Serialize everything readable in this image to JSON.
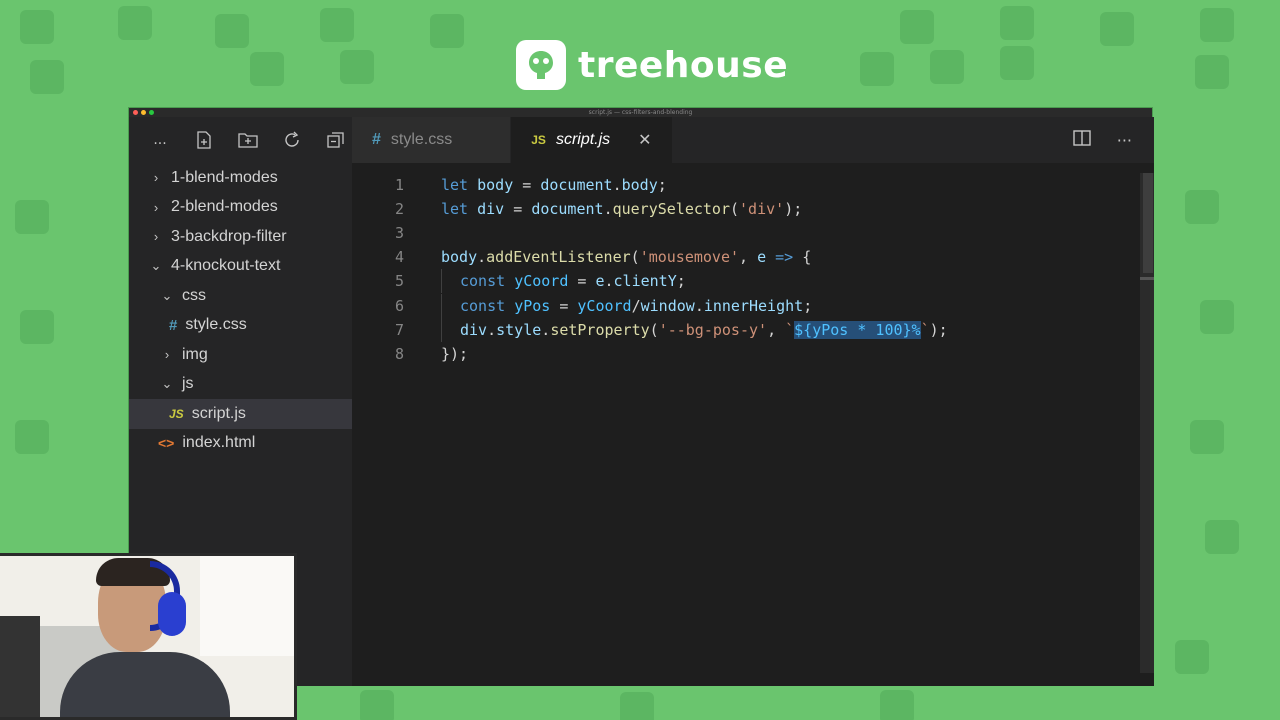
{
  "brand": {
    "name": "treehouse"
  },
  "window": {
    "title": "script.js — css-filters-and-blending"
  },
  "sidebar": {
    "toolbar": {
      "more": "...",
      "icons": [
        "new-file-icon",
        "new-folder-icon",
        "refresh-icon",
        "collapse-all-icon"
      ]
    },
    "items": [
      {
        "label": "1-blend-modes",
        "twisty": "›"
      },
      {
        "label": "2-blend-modes",
        "twisty": "›"
      },
      {
        "label": "3-backdrop-filter",
        "twisty": "›"
      },
      {
        "label": "4-knockout-text",
        "twisty": "⌄"
      },
      {
        "label": "css",
        "twisty": "⌄"
      },
      {
        "label": "style.css",
        "icon": "#"
      },
      {
        "label": "img",
        "twisty": "›"
      },
      {
        "label": "js",
        "twisty": "⌄"
      },
      {
        "label": "script.js",
        "icon": "JS"
      },
      {
        "label": "index.html",
        "icon": "<>"
      }
    ]
  },
  "tabs": [
    {
      "label": "style.css",
      "icon": "#"
    },
    {
      "label": "script.js",
      "icon": "JS",
      "close": "✕"
    }
  ],
  "tab_actions": {
    "split": "▯▯",
    "more": "···"
  },
  "code": {
    "line_numbers": [
      "1",
      "2",
      "3",
      "4",
      "5",
      "6",
      "7",
      "8"
    ],
    "l1": {
      "kw": "let",
      "var": "body",
      "rest": " = ",
      "obj": "document",
      "dot": ".",
      "prop": "body",
      "end": ";"
    },
    "l2": {
      "kw": "let",
      "var": "div",
      "eq": " = ",
      "obj": "document",
      "dot": ".",
      "fn": "querySelector",
      "open": "(",
      "str": "'div'",
      "end": ");"
    },
    "l4": {
      "obj": "body",
      "dot": ".",
      "fn": "addEventListener",
      "open": "(",
      "str": "'mousemove'",
      "comma": ", ",
      "param": "e",
      "arrow": " => ",
      "brace": "{"
    },
    "l5": {
      "kw": "const",
      "var": "yCoord",
      "eq": " = ",
      "obj": "e",
      "dot": ".",
      "prop": "clientY",
      "end": ";"
    },
    "l6": {
      "kw": "const",
      "var": "yPos",
      "eq": " = ",
      "obj": "yCoord",
      "slash": "/",
      "obj2": "window",
      "dot": ".",
      "prop": "innerHeight",
      "end": ";"
    },
    "l7": {
      "obj": "div",
      "dot": ".",
      "prop": "style",
      "dot2": ".",
      "fn": "setProperty",
      "open": "(",
      "str": "'--bg-pos-y'",
      "comma": ", ",
      "tick": "`",
      "sel": "${yPos * 100}%",
      "tick2": "`",
      "end": ");"
    },
    "l8": {
      "text": "});"
    }
  }
}
